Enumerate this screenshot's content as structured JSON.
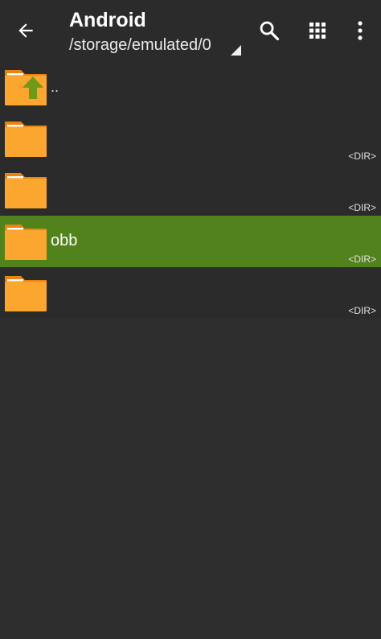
{
  "appbar": {
    "title": "Android",
    "path": "/storage/emulated/0",
    "icons": [
      "back-arrow-icon",
      "search-icon",
      "grid-view-icon",
      "more-vert-icon"
    ]
  },
  "colors": {
    "background": "#2e2e2e",
    "selected_row": "#52821b",
    "folder": "#fba62e",
    "folder_tab": "#ec8510",
    "up_arrow": "#6e9a18"
  },
  "list": {
    "parent": {
      "label": ".."
    },
    "items": [
      {
        "name": "",
        "tag": "<DIR>",
        "selected": false
      },
      {
        "name": "",
        "tag": "<DIR>",
        "selected": false
      },
      {
        "name": "obb",
        "tag": "<DIR>",
        "selected": true
      },
      {
        "name": "",
        "tag": "<DIR>",
        "selected": false
      }
    ]
  }
}
